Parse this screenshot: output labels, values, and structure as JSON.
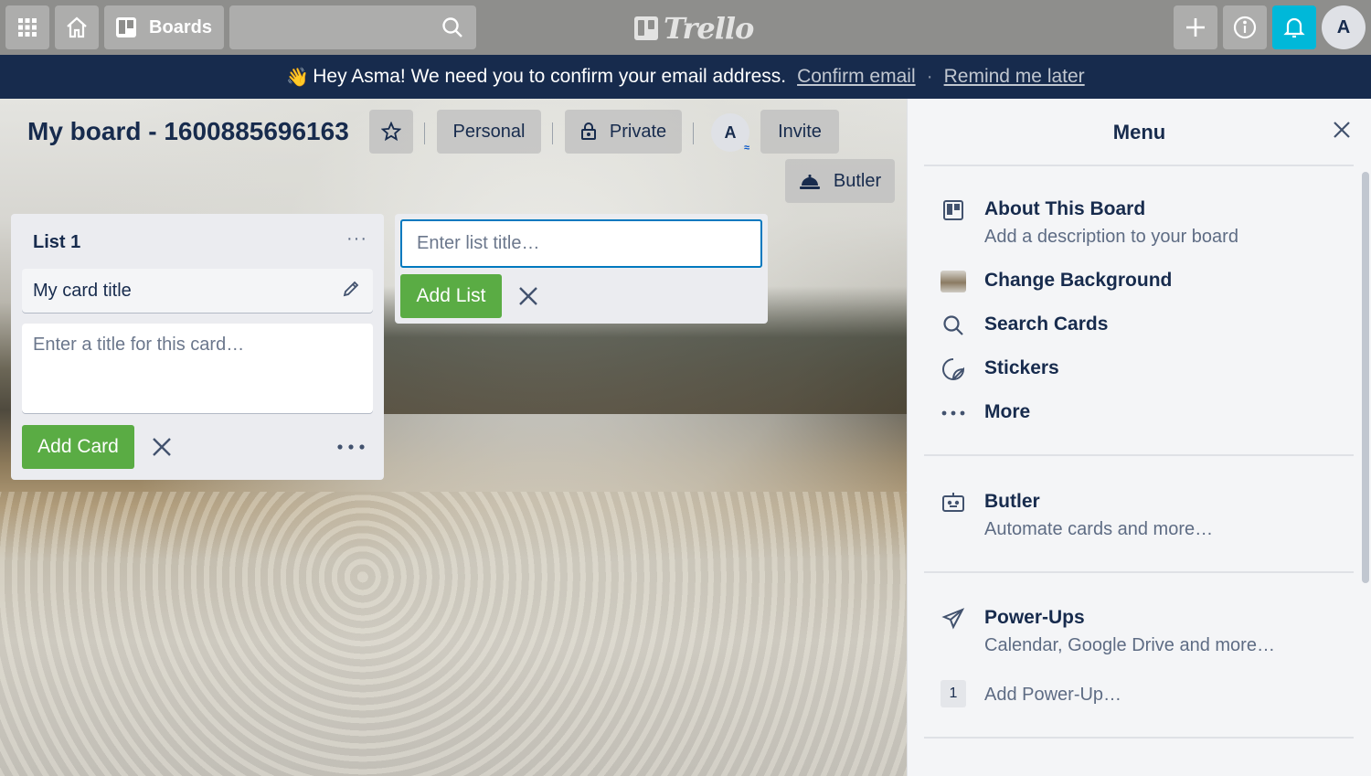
{
  "header": {
    "boards_label": "Boards",
    "logo_text": "Trello",
    "avatar_initial": "A"
  },
  "banner": {
    "message": "Hey Asma! We need you to confirm your email address.",
    "confirm_link": "Confirm email",
    "separator": "·",
    "remind_link": "Remind me later"
  },
  "board": {
    "title": "My board - 1600885696163",
    "personal_label": "Personal",
    "private_label": "Private",
    "member_initial": "A",
    "invite_label": "Invite",
    "butler_label": "Butler"
  },
  "lists": [
    {
      "title": "List 1",
      "menu": "···",
      "cards": [
        {
          "title": "My card title"
        }
      ],
      "compose_placeholder": "Enter a title for this card…",
      "add_card_label": "Add Card"
    }
  ],
  "new_list": {
    "placeholder": "Enter list title…",
    "add_list_label": "Add List"
  },
  "menu": {
    "title": "Menu",
    "items": [
      {
        "label": "About This Board",
        "sub": "Add a description to your board",
        "icon": "board-icon"
      },
      {
        "label": "Change Background",
        "icon": "background-thumb"
      },
      {
        "label": "Search Cards",
        "icon": "search-icon"
      },
      {
        "label": "Stickers",
        "icon": "sticker-icon"
      },
      {
        "label": "More",
        "icon": "more-icon"
      }
    ],
    "butler": {
      "label": "Butler",
      "sub": "Automate cards and more…"
    },
    "powerups": {
      "label": "Power-Ups",
      "sub": "Calendar, Google Drive and more…",
      "count": "1",
      "add_label": "Add Power-Up…"
    }
  },
  "colors": {
    "green": "#5aac44",
    "navy": "#172b4d",
    "notify": "#00b8d9",
    "focus": "#0079bf"
  }
}
